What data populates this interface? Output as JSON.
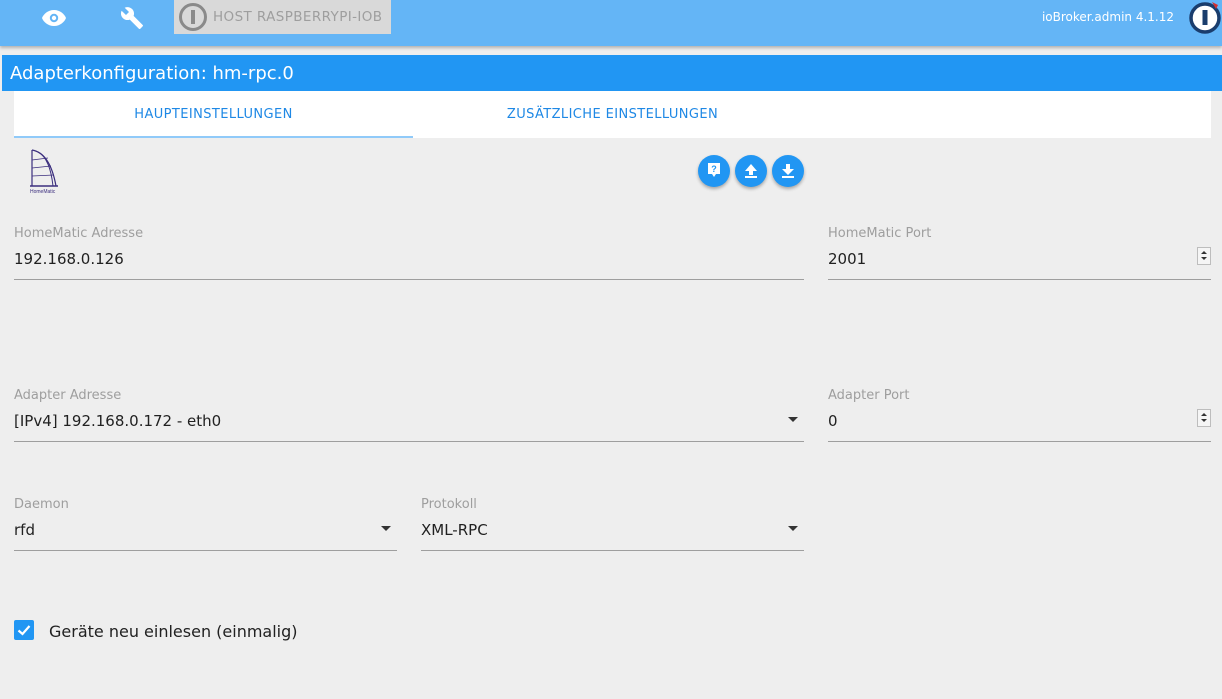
{
  "topbar": {
    "icons": [
      "eye-icon",
      "wrench-icon"
    ],
    "host_label": "HOST RASPBERRYPI-IOB",
    "version": "ioBroker.admin 4.1.12"
  },
  "titlebar": {
    "title": "Adapterkonfiguration: hm-rpc.0"
  },
  "tabs": [
    {
      "label": "HAUPTEINSTELLUNGEN",
      "active": true
    },
    {
      "label": "ZUSÄTZLICHE EINSTELLUNGEN",
      "active": false
    }
  ],
  "adapter": {
    "logo_text": "HomeMatic"
  },
  "actions": [
    "help-icon",
    "upload-icon",
    "download-icon"
  ],
  "form": {
    "hm_address": {
      "label": "HomeMatic Adresse",
      "value": "192.168.0.126"
    },
    "hm_port": {
      "label": "HomeMatic Port",
      "value": "2001"
    },
    "adapter_address": {
      "label": "Adapter Adresse",
      "value": "[IPv4] 192.168.0.172 - eth0"
    },
    "adapter_port": {
      "label": "Adapter Port",
      "value": "0"
    },
    "daemon": {
      "label": "Daemon",
      "value": "rfd"
    },
    "protocol": {
      "label": "Protokoll",
      "value": "XML-RPC"
    },
    "reread": {
      "label": "Geräte neu einlesen (einmalig)",
      "checked": true
    }
  },
  "colors": {
    "topbar": "#64b5f6",
    "accent": "#2196f3",
    "background": "#eeeeee"
  }
}
